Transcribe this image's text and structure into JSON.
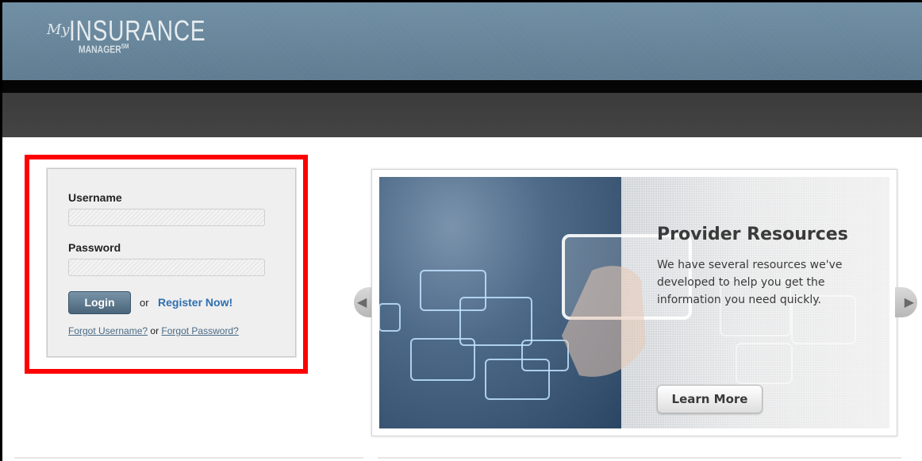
{
  "header": {
    "logo_my": "My",
    "logo_insurance": "INSURANCE",
    "logo_manager": "MANAGER",
    "logo_sm": "SM"
  },
  "login": {
    "username_label": "Username",
    "username_value": "",
    "password_label": "Password",
    "password_value": "",
    "login_button": "Login",
    "or_text": "or",
    "register_link": "Register Now!",
    "forgot_username": "Forgot Username?",
    "forgot_or": "or",
    "forgot_password": "Forgot Password?"
  },
  "promo": {
    "title": "Provider Resources",
    "text": "We have several resources we've developed to help you get the information you need quickly.",
    "button": "Learn More",
    "prev_icon": "chevron-left-icon",
    "next_icon": "chevron-right-icon"
  },
  "colors": {
    "header": "#6480a0",
    "highlight": "#ff0000",
    "link": "#2f6fb0"
  }
}
